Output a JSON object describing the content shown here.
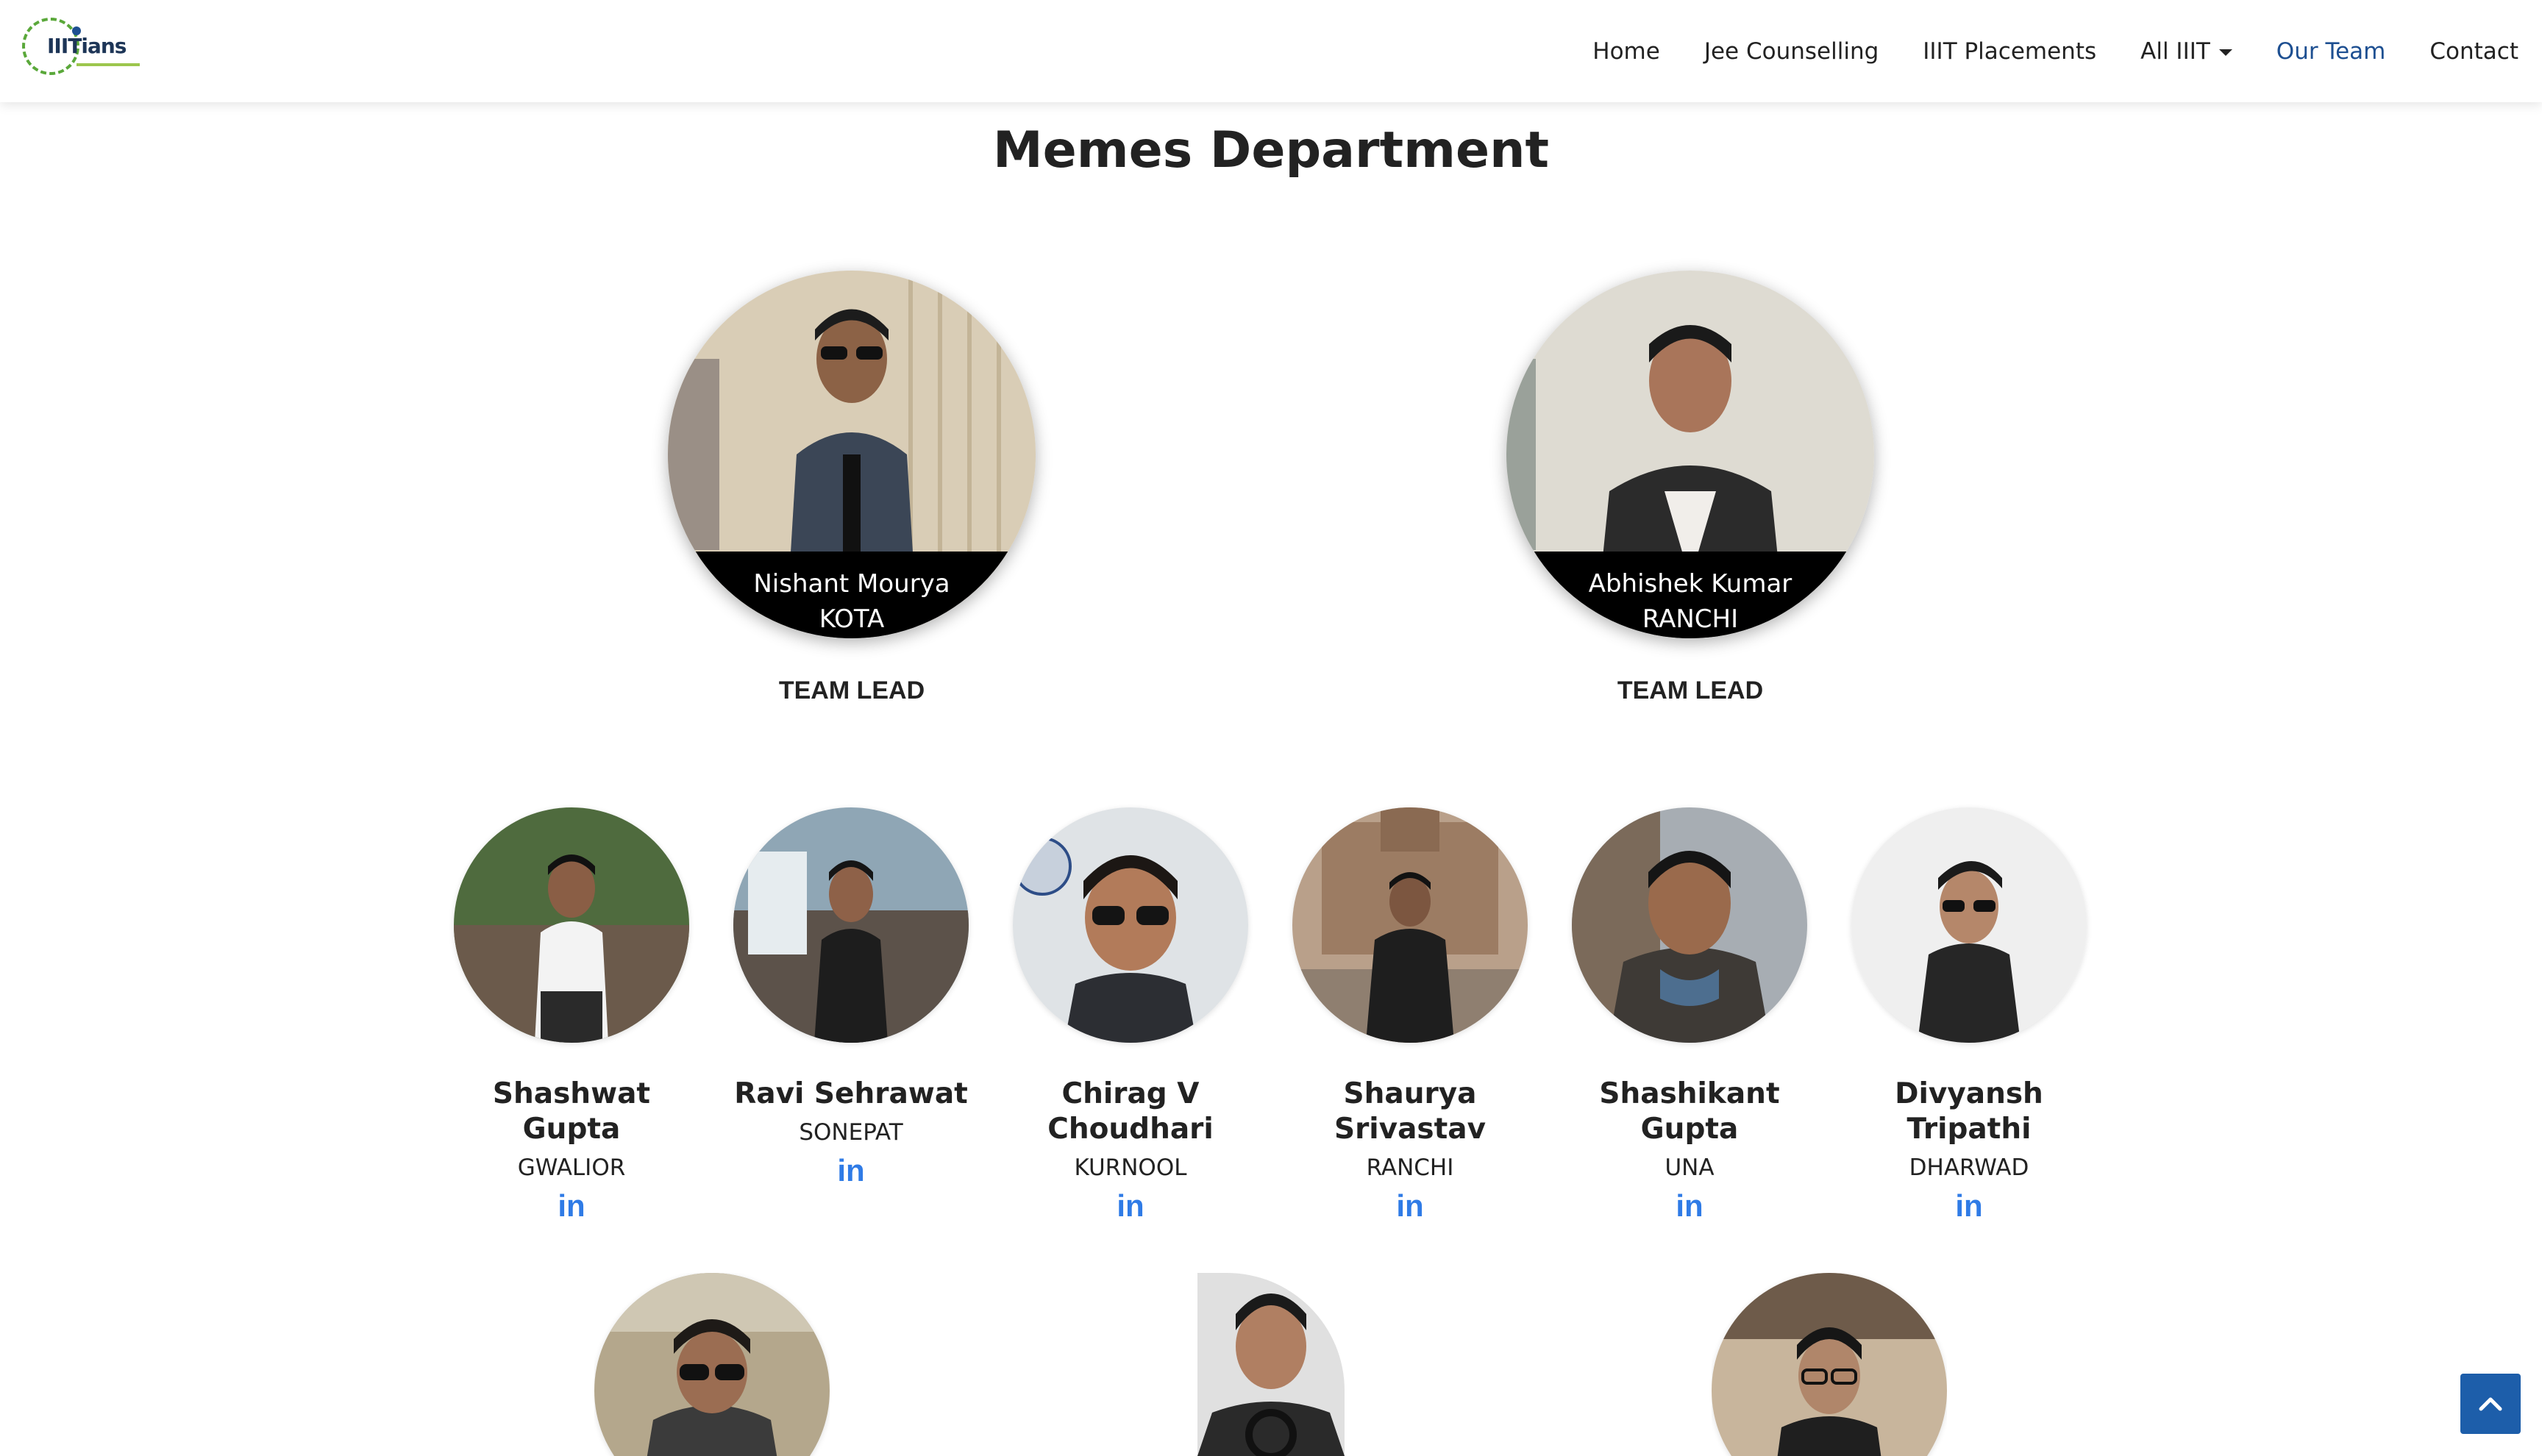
{
  "nav": {
    "logo_text": "IIITians",
    "items": [
      {
        "label": "Home"
      },
      {
        "label": "Jee Counselling"
      },
      {
        "label": "IIIT Placements"
      },
      {
        "label": "All IIIT"
      },
      {
        "label": "Our Team"
      },
      {
        "label": "Contact"
      }
    ],
    "active": "Our Team"
  },
  "department": {
    "title": "Memes Department",
    "leads": [
      {
        "name": "Nishant Mourya",
        "city": "KOTA",
        "role": "TEAM LEAD"
      },
      {
        "name": "Abhishek Kumar",
        "city": "RANCHI",
        "role": "TEAM LEAD"
      }
    ],
    "members": [
      {
        "name": "Shashwat Gupta",
        "city": "GWALIOR"
      },
      {
        "name": "Ravi Sehrawat",
        "city": "SONEPAT"
      },
      {
        "name": "Chirag V Choudhari",
        "city": "KURNOOL"
      },
      {
        "name": "Shaurya Srivastav",
        "city": "RANCHI"
      },
      {
        "name": "Shashikant Gupta",
        "city": "UNA"
      },
      {
        "name": "Divyansh Tripathi",
        "city": "DHARWAD"
      }
    ],
    "linkedin_label": "in"
  },
  "colors": {
    "accent": "#1d4f91",
    "linkedin": "#2f7be6",
    "back_to_top": "#1d5eaa"
  },
  "icons": {
    "back_to_top": "chevron-up-icon",
    "social": "linkedin-icon"
  }
}
